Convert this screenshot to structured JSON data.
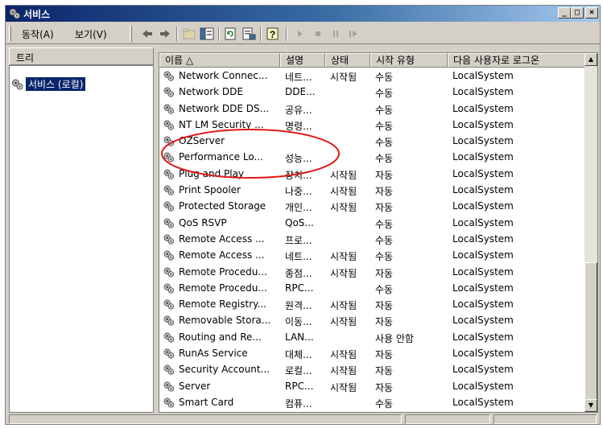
{
  "window": {
    "title": "서비스"
  },
  "title_buttons": {
    "minimize": "_",
    "maximize": "□",
    "close": "×"
  },
  "menu": {
    "action": "동작(A)",
    "view": "보기(V)"
  },
  "toolbar_icons": [
    "back-icon",
    "forward-icon",
    "up-folder-icon",
    "show-tree-icon",
    "refresh-icon",
    "export-list-icon",
    "help-icon",
    "play-icon",
    "stop-icon",
    "pause-icon",
    "restart-icon"
  ],
  "tree": {
    "header": "트리",
    "root_label": "서비스 (로컬)"
  },
  "list": {
    "columns": {
      "name": "이름 △",
      "description": "설명",
      "status": "상태",
      "startup": "시작 유형",
      "logon": "다음 사용자로 로그온"
    },
    "rows": [
      {
        "name": "Network Connec...",
        "description": "네트...",
        "status": "시작됨",
        "startup": "수동",
        "logon": "LocalSystem"
      },
      {
        "name": "Network DDE",
        "description": "DDE...",
        "status": "",
        "startup": "수동",
        "logon": "LocalSystem"
      },
      {
        "name": "Network DDE DS...",
        "description": "공유...",
        "status": "",
        "startup": "수동",
        "logon": "LocalSystem"
      },
      {
        "name": "NT LM Security ...",
        "description": "명령...",
        "status": "",
        "startup": "수동",
        "logon": "LocalSystem"
      },
      {
        "name": "OZServer",
        "description": "",
        "status": "",
        "startup": "수동",
        "logon": "LocalSystem"
      },
      {
        "name": "Performance Lo...",
        "description": "성능...",
        "status": "",
        "startup": "수동",
        "logon": "LocalSystem"
      },
      {
        "name": "Plug and Play",
        "description": "장치...",
        "status": "시작됨",
        "startup": "자동",
        "logon": "LocalSystem"
      },
      {
        "name": "Print Spooler",
        "description": "나중...",
        "status": "시작됨",
        "startup": "자동",
        "logon": "LocalSystem"
      },
      {
        "name": "Protected Storage",
        "description": "개인...",
        "status": "시작됨",
        "startup": "자동",
        "logon": "LocalSystem"
      },
      {
        "name": "QoS RSVP",
        "description": "QoS...",
        "status": "",
        "startup": "수동",
        "logon": "LocalSystem"
      },
      {
        "name": "Remote Access ...",
        "description": "프로...",
        "status": "",
        "startup": "수동",
        "logon": "LocalSystem"
      },
      {
        "name": "Remote Access ...",
        "description": "네트...",
        "status": "시작됨",
        "startup": "수동",
        "logon": "LocalSystem"
      },
      {
        "name": "Remote Procedu...",
        "description": "종점...",
        "status": "시작됨",
        "startup": "자동",
        "logon": "LocalSystem"
      },
      {
        "name": "Remote Procedu...",
        "description": "RPC...",
        "status": "",
        "startup": "수동",
        "logon": "LocalSystem"
      },
      {
        "name": "Remote Registry...",
        "description": "원격...",
        "status": "시작됨",
        "startup": "자동",
        "logon": "LocalSystem"
      },
      {
        "name": "Removable Stora...",
        "description": "이동...",
        "status": "시작됨",
        "startup": "자동",
        "logon": "LocalSystem"
      },
      {
        "name": "Routing and Re...",
        "description": "LAN...",
        "status": "",
        "startup": "사용 안함",
        "logon": "LocalSystem"
      },
      {
        "name": "RunAs Service",
        "description": "대체...",
        "status": "시작됨",
        "startup": "자동",
        "logon": "LocalSystem"
      },
      {
        "name": "Security Account...",
        "description": "로컬...",
        "status": "시작됨",
        "startup": "자동",
        "logon": "LocalSystem"
      },
      {
        "name": "Server",
        "description": "RPC...",
        "status": "시작됨",
        "startup": "자동",
        "logon": "LocalSystem"
      },
      {
        "name": "Smart Card",
        "description": "컴퓨...",
        "status": "",
        "startup": "수동",
        "logon": "LocalSystem"
      }
    ]
  },
  "colors": {
    "titlebar": "#0a246a",
    "selection": "#0a246a",
    "annotation": "#e01818",
    "face": "#d4d0c8"
  }
}
